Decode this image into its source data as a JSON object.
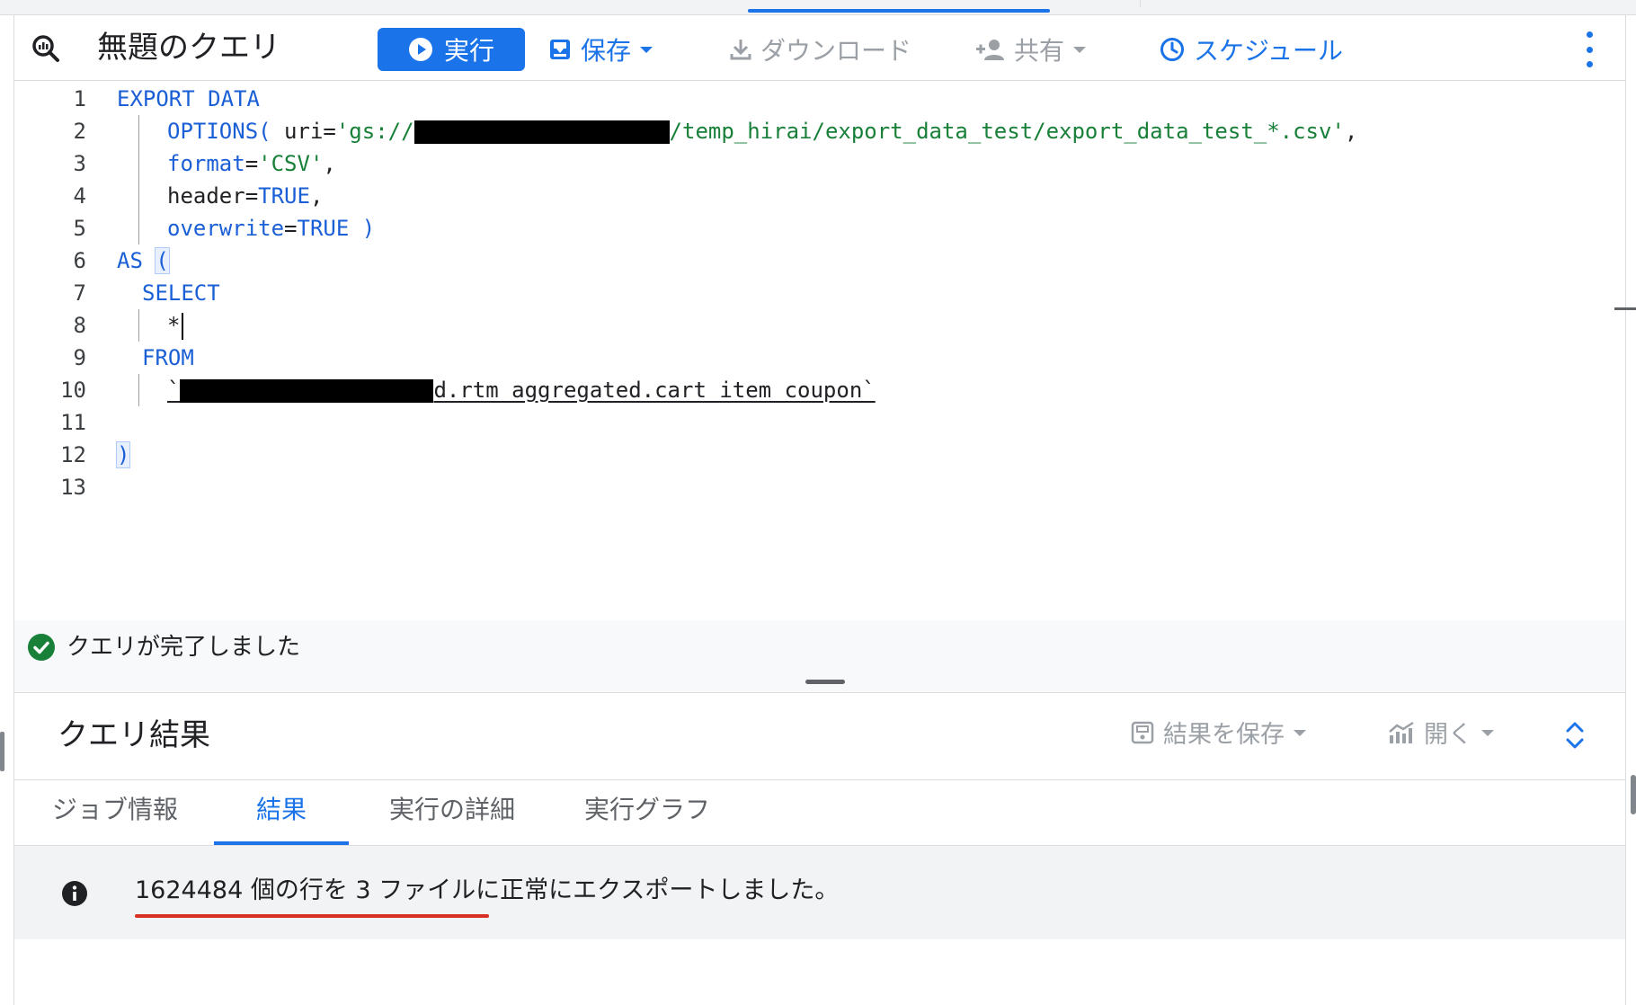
{
  "toolbar": {
    "title": "無題のクエリ",
    "run_label": "実行",
    "save_label": "保存",
    "download_label": "ダウンロード",
    "share_label": "共有",
    "schedule_label": "スケジュール"
  },
  "editor": {
    "line_numbers": [
      "1",
      "2",
      "3",
      "4",
      "5",
      "6",
      "7",
      "8",
      "9",
      "10",
      "11",
      "12",
      "13"
    ],
    "tokens": {
      "l1_kw": "EXPORT DATA",
      "l2_kw": "OPTIONS(",
      "l2_id": " uri=",
      "l2_str_a": "'gs://",
      "l2_str_b": "/temp_hirai/export_data_test/export_data_test_*.csv'",
      "l2_end": ",",
      "l3_kw": "format",
      "l3_eq": "=",
      "l3_str": "'CSV'",
      "l3_end": ",",
      "l4_id": "header=",
      "l4_kw": "TRUE",
      "l4_end": ",",
      "l5_kw": "overwrite",
      "l5_eq": "=",
      "l5_kw2": "TRUE )",
      "l6_kw": "AS",
      "l6_paren": "(",
      "l7_kw": "SELECT",
      "l8_id": "*",
      "l9_kw": "FROM",
      "l10_tick": "`",
      "l10_id": "d.rtm_aggregated.cart_item_coupon`",
      "l12_paren": ")"
    }
  },
  "status": {
    "text": "クエリが完了しました",
    "icon": "check-circle-icon",
    "color": "#188038"
  },
  "results": {
    "title": "クエリ結果",
    "save_results_label": "結果を保存",
    "open_label": "開く",
    "tabs": [
      {
        "label": "ジョブ情報"
      },
      {
        "label": "結果"
      },
      {
        "label": "実行の詳細"
      },
      {
        "label": "実行グラフ"
      }
    ],
    "active_tab": "結果",
    "message": "1624484 個の行を 3 ファイルに正常にエクスポートしました。"
  },
  "colors": {
    "accent": "#1a73e8",
    "keyword": "#1a5fd6",
    "string": "#188038",
    "highlight_underline": "#d93025"
  }
}
